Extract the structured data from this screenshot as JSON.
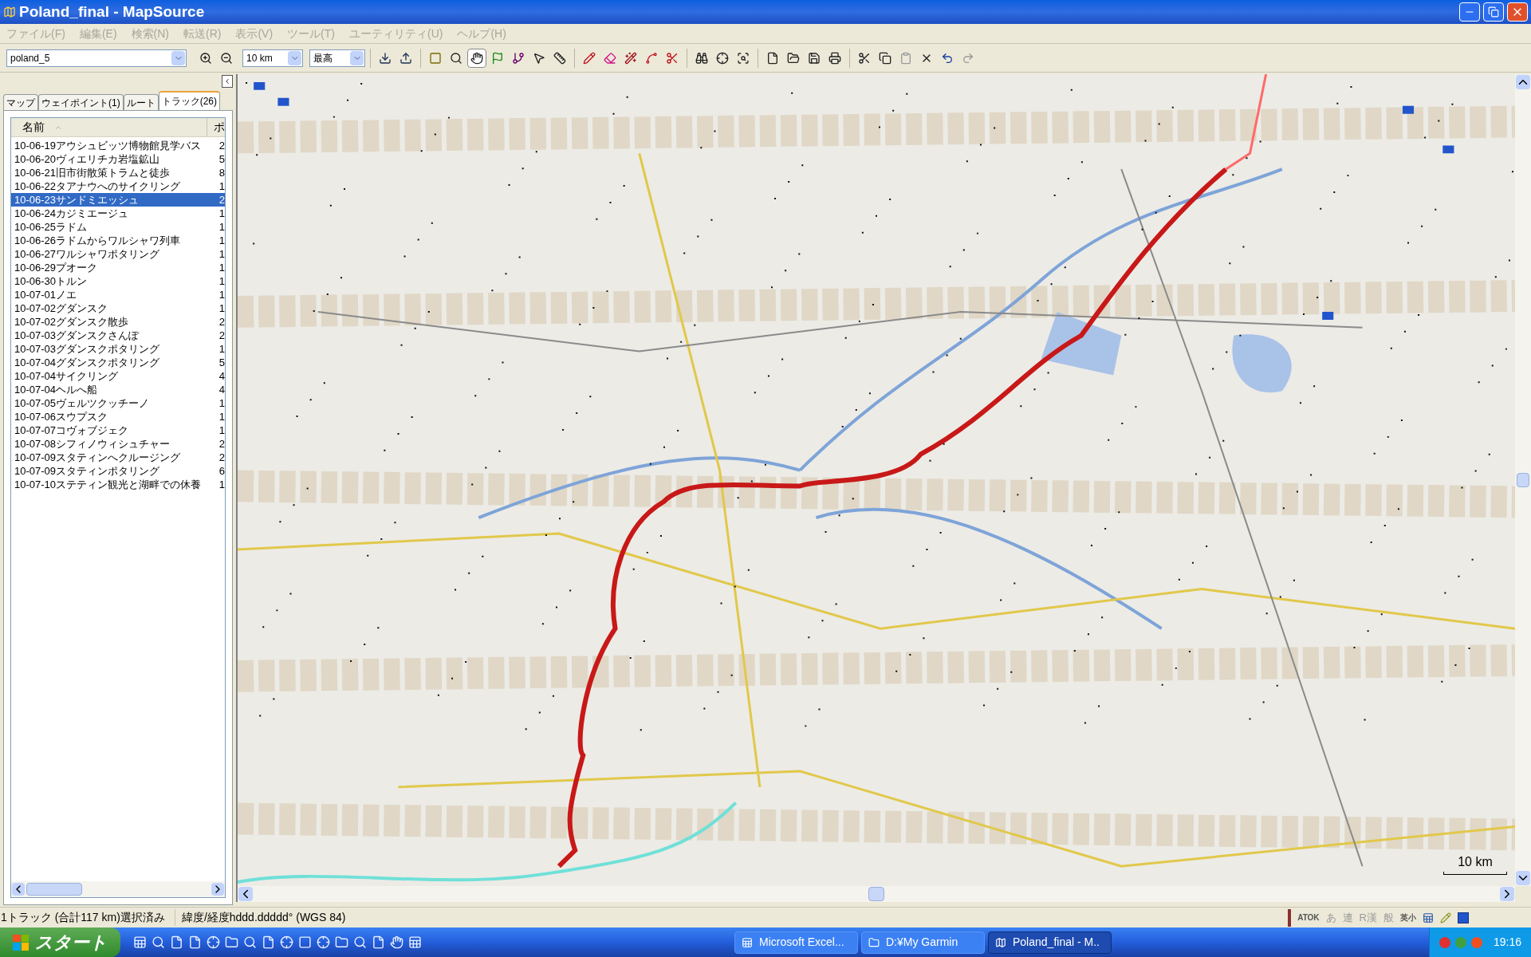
{
  "window": {
    "title": "Poland_final - MapSource"
  },
  "menu": [
    "ファイル(F)",
    "編集(E)",
    "検索(N)",
    "転送(R)",
    "表示(V)",
    "ツール(T)",
    "ユーティリティ(U)",
    "ヘルプ(H)"
  ],
  "toolbar": {
    "map_dropdown": "poland_5",
    "scale_dropdown": "10 km",
    "detail_dropdown": "最高",
    "tools": [
      {
        "kind": "zoom-in",
        "selected": false
      },
      {
        "kind": "zoom-out",
        "selected": false
      },
      {
        "kind": "sep"
      },
      {
        "kind": "receive",
        "selected": false
      },
      {
        "kind": "send",
        "selected": false
      },
      {
        "kind": "sep"
      },
      {
        "kind": "area",
        "selected": false
      },
      {
        "kind": "zoom",
        "selected": false
      },
      {
        "kind": "hand",
        "selected": true
      },
      {
        "kind": "flag",
        "selected": false
      },
      {
        "kind": "route",
        "selected": false
      },
      {
        "kind": "pointer",
        "selected": false
      },
      {
        "kind": "ruler",
        "selected": false
      },
      {
        "kind": "sep"
      },
      {
        "kind": "pencil",
        "selected": false
      },
      {
        "kind": "eraser",
        "selected": false
      },
      {
        "kind": "wand",
        "selected": false
      },
      {
        "kind": "connect",
        "selected": false
      },
      {
        "kind": "scissors",
        "selected": false
      },
      {
        "kind": "sep"
      },
      {
        "kind": "binoculars",
        "selected": false
      },
      {
        "kind": "target",
        "selected": false
      },
      {
        "kind": "find",
        "selected": false
      },
      {
        "kind": "sep"
      },
      {
        "kind": "new",
        "selected": false
      },
      {
        "kind": "open",
        "selected": false
      },
      {
        "kind": "save",
        "selected": false
      },
      {
        "kind": "print",
        "selected": false
      },
      {
        "kind": "sep"
      },
      {
        "kind": "cut",
        "selected": false
      },
      {
        "kind": "copy",
        "selected": false
      },
      {
        "kind": "paste",
        "selected": false
      },
      {
        "kind": "delete",
        "selected": false
      },
      {
        "kind": "undo",
        "selected": false
      },
      {
        "kind": "redo",
        "selected": false
      }
    ]
  },
  "tabs": [
    {
      "label": "マップ",
      "selected": false
    },
    {
      "label": "ウェイポイント(1)",
      "selected": false
    },
    {
      "label": "ルート",
      "selected": false
    },
    {
      "label": "トラック(26)",
      "selected": true
    }
  ],
  "table": {
    "columns": [
      "名前",
      "ポ"
    ],
    "rows": [
      {
        "name": "10-06-19アウシュビッツ博物館見学バス",
        "column_2": "2",
        "selected": false
      },
      {
        "name": "10-06-20ヴィエリチカ岩塩鉱山",
        "column_2": "5",
        "selected": false
      },
      {
        "name": "10-06-21旧市街散策トラムと徒歩",
        "column_2": "8",
        "selected": false
      },
      {
        "name": "10-06-22タアナウへのサイクリング",
        "column_2": "1",
        "selected": false
      },
      {
        "name": "10-06-23サンドミエッシュ",
        "column_2": "2",
        "selected": true
      },
      {
        "name": "10-06-24カジミエージュ",
        "column_2": "1",
        "selected": false
      },
      {
        "name": "10-06-25ラドム",
        "column_2": "1",
        "selected": false
      },
      {
        "name": "10-06-26ラドムからワルシャワ列車",
        "column_2": "1",
        "selected": false
      },
      {
        "name": "10-06-27ワルシャワポタリング",
        "column_2": "1",
        "selected": false
      },
      {
        "name": "10-06-29プオーク",
        "column_2": "1",
        "selected": false
      },
      {
        "name": "10-06-30トルン",
        "column_2": "1",
        "selected": false
      },
      {
        "name": "10-07-01ノエ",
        "column_2": "1",
        "selected": false
      },
      {
        "name": "10-07-02グダンスク",
        "column_2": "1",
        "selected": false
      },
      {
        "name": "10-07-02グダンスク散歩",
        "column_2": "2",
        "selected": false
      },
      {
        "name": "10-07-03グダンスクさんぽ",
        "column_2": "2",
        "selected": false
      },
      {
        "name": "10-07-03グダンスクポタリング",
        "column_2": "1",
        "selected": false
      },
      {
        "name": "10-07-04グダンスクポタリング",
        "column_2": "5",
        "selected": false
      },
      {
        "name": "10-07-04サイクリング",
        "column_2": "4",
        "selected": false
      },
      {
        "name": "10-07-04ヘルへ船",
        "column_2": "4",
        "selected": false
      },
      {
        "name": "10-07-05ヴェルツクッチーノ",
        "column_2": "1",
        "selected": false
      },
      {
        "name": "10-07-06スウプスク",
        "column_2": "1",
        "selected": false
      },
      {
        "name": "10-07-07コヴォブジェク",
        "column_2": "1",
        "selected": false
      },
      {
        "name": "10-07-08シフィノウィシュチャー",
        "column_2": "2",
        "selected": false
      },
      {
        "name": "10-07-09スタティンへクルージング",
        "column_2": "2",
        "selected": false
      },
      {
        "name": "10-07-09スタティンポタリング",
        "column_2": "6",
        "selected": false
      },
      {
        "name": "10-07-10ステティン観光と湖畔での休養",
        "column_2": "1",
        "selected": false
      }
    ]
  },
  "map": {
    "kind": "picture",
    "scale": "10 km"
  },
  "status_bar": [
    "1トラック (合計117 km)選択済み",
    "緯度/経度hddd.ddddd° (WGS 84)"
  ],
  "ime_bar": [
    "ATOK",
    "あ",
    "連",
    "R漢",
    "般",
    "英小"
  ],
  "taskbar": {
    "start": "スタート",
    "tasks": [
      {
        "label": "Microsoft Excel...",
        "selected": false
      },
      {
        "label": "D:¥My Garmin",
        "selected": false
      },
      {
        "label": "Poland_final - M..",
        "selected": true
      }
    ],
    "clock": "19:16"
  }
}
